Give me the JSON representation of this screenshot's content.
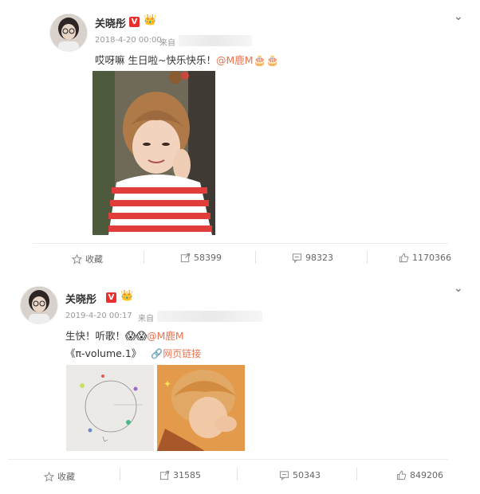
{
  "post1": {
    "author": "关晓彤",
    "time": "2018-4-20 00:00",
    "source_prefix": "来自",
    "text_before": "哎呀嘛 生日啦~快乐快乐！",
    "mention": "@M鹿M",
    "emoji": "🎂🎂",
    "actions": {
      "favorite": "收藏",
      "repost": "58399",
      "comment": "98323",
      "like": "1170366"
    }
  },
  "post2": {
    "author": "关晓彤",
    "time": "2019-4-20 00:17",
    "source_prefix": "来自",
    "text_before": "生快！听歌！",
    "emoji": "😱😱",
    "mention": "@M鹿M",
    "song": "《π-volume.1》",
    "link_label": "网页链接",
    "actions": {
      "favorite": "收藏",
      "repost": "31585",
      "comment": "50343",
      "like": "849206"
    }
  },
  "icons": {
    "chevron": "chevron-down-icon",
    "verified": "verified-v-icon",
    "crown": "crown-icon",
    "star": "star-icon",
    "repost": "repost-icon",
    "comment": "comment-icon",
    "like": "thumbs-up-icon",
    "link": "link-icon"
  },
  "colors": {
    "mention": "#eb7350",
    "verified": "#e8312f",
    "meta": "#999999"
  }
}
